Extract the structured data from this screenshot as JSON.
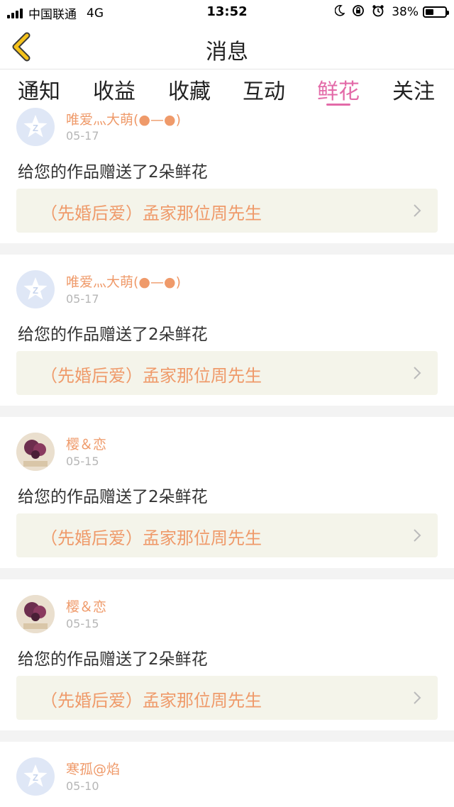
{
  "status_bar": {
    "carrier": "中国联通",
    "network": "4G",
    "time": "13:52",
    "battery": "38%",
    "icons": [
      "signal-icon",
      "moon-icon",
      "rotation-lock-icon",
      "alarm-icon",
      "battery-icon"
    ]
  },
  "nav": {
    "title": "消息",
    "back_icon": "chevron-left-icon",
    "accent": "#f5c21b"
  },
  "tabs": [
    {
      "label": "通知"
    },
    {
      "label": "收益"
    },
    {
      "label": "收藏"
    },
    {
      "label": "互动"
    },
    {
      "label": "鲜花",
      "active": true
    },
    {
      "label": "关注"
    }
  ],
  "colors": {
    "active_tab": "#e36aa8",
    "username": "#ef9a6a",
    "work_title": "#ef9a6a",
    "date": "#b6b6b6",
    "work_box_bg": "#f4f4ea"
  },
  "messages": [
    {
      "user": "唯爱灬大萌(●—●)",
      "date": "05-17",
      "text": "给您的作品赠送了2朵鲜花",
      "work": "（先婚后爱）孟家那位周先生",
      "avatar": "default-avatar-icon"
    },
    {
      "user": "唯爱灬大萌(●—●)",
      "date": "05-17",
      "text": "给您的作品赠送了2朵鲜花",
      "work": "（先婚后爱）孟家那位周先生",
      "avatar": "default-avatar-icon"
    },
    {
      "user": "樱＆恋",
      "date": "05-15",
      "text": "给您的作品赠送了2朵鲜花",
      "work": "（先婚后爱）孟家那位周先生",
      "avatar": "photo-avatar"
    },
    {
      "user": "樱＆恋",
      "date": "05-15",
      "text": "给您的作品赠送了2朵鲜花",
      "work": "（先婚后爱）孟家那位周先生",
      "avatar": "photo-avatar"
    },
    {
      "user": "寒孤@焰",
      "date": "05-10",
      "avatar": "default-avatar-icon"
    }
  ]
}
